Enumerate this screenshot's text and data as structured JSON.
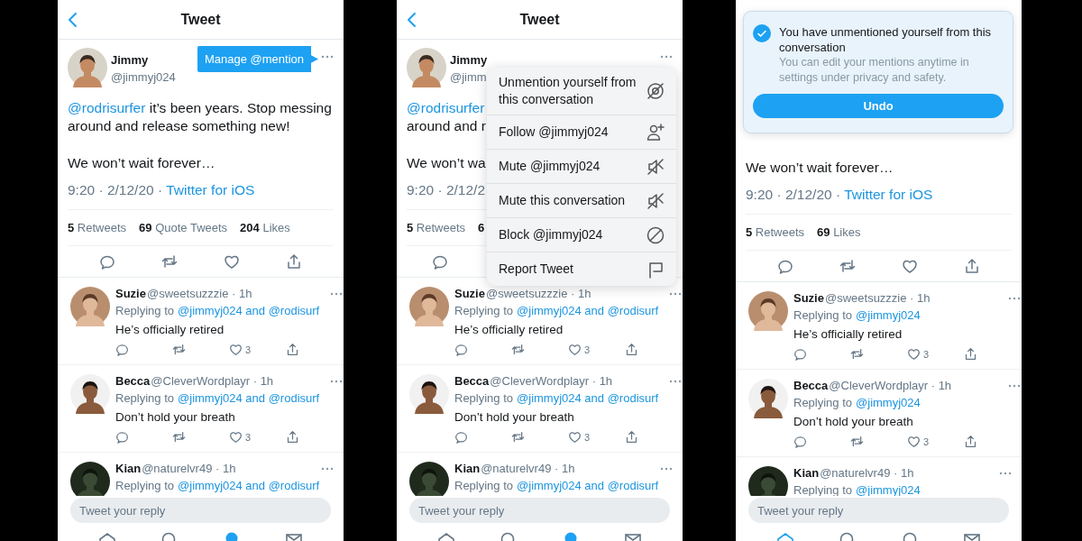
{
  "phones": [
    {
      "header": {
        "title": "Tweet"
      },
      "tweet": {
        "name": "Jimmy",
        "handle": "@jimmyj024",
        "body": [
          {
            "kind": "mention",
            "text": "@rodrisurfer"
          },
          {
            "kind": "text",
            "text": " it’s been years. Stop messing around and release something new!"
          }
        ],
        "body2": "We won’t wait forever…",
        "timestamp": "9:20 · 2/12/20 ·",
        "source": "Twitter for iOS",
        "stats": [
          {
            "count": "5",
            "label": "Retweets"
          },
          {
            "count": "69",
            "label": "Quote Tweets"
          },
          {
            "count": "204",
            "label": "Likes"
          }
        ],
        "actions": [
          {
            "kind": "reply"
          },
          {
            "kind": "retweet"
          },
          {
            "kind": "like"
          },
          {
            "kind": "share"
          }
        ]
      },
      "tooltip": {
        "label": "Manage @mention"
      },
      "replies": [
        {
          "name": "Suzie",
          "handle": "@sweetsuzzzie · 1h",
          "reply_to_label": "Replying to",
          "reply_to": "@jimmyj024 and @rodisurf",
          "text": "He’s officially retired",
          "likes": "3"
        },
        {
          "name": "Becca",
          "handle": "@CleverWordplayr · 1h",
          "reply_to_label": "Replying to",
          "reply_to": "@jimmyj024 and @rodisurf",
          "text": "Don’t hold your breath",
          "likes": "3"
        },
        {
          "name": "Kian",
          "handle": "@naturelvr49 · 1h",
          "reply_to_label": "Replying to",
          "reply_to": "@jimmyj024 and @rodisurf"
        }
      ],
      "compose": {
        "placeholder": "Tweet your reply"
      },
      "nav": [
        {
          "kind": "home",
          "selected": false
        },
        {
          "kind": "search",
          "selected": false
        },
        {
          "kind": "notifications",
          "selected": false,
          "badge": true
        },
        {
          "kind": "messages",
          "selected": false
        }
      ]
    },
    {
      "header": {
        "title": "Tweet"
      },
      "tweet": {
        "name": "Jimmy",
        "handle": "@jimm",
        "body": [
          {
            "kind": "mention",
            "text": "@rodrisurfer"
          },
          {
            "kind": "break"
          },
          {
            "kind": "text",
            "text": "around and r"
          }
        ],
        "body2": "We won’t wa",
        "timestamp": "9:20 · 2/12/2",
        "stats": [
          {
            "count": "5",
            "label": "Retweets"
          },
          {
            "count": "6"
          }
        ],
        "actions": [
          {
            "kind": "reply"
          }
        ]
      },
      "menu": {
        "items": [
          {
            "label": "Unmention yourself from this conversation",
            "kind": "unmention"
          },
          {
            "label": "Follow @jimmyj024",
            "kind": "follow"
          },
          {
            "label": "Mute @jimmyj024",
            "kind": "mute"
          },
          {
            "label": "Mute this conversation",
            "kind": "mute"
          },
          {
            "label": "Block @jimmyj024",
            "kind": "block"
          },
          {
            "label": "Report Tweet",
            "kind": "report"
          }
        ]
      },
      "replies": [
        {
          "name": "Suzie",
          "handle": "@sweetsuzzzie · 1h",
          "reply_to_label": "Replying to",
          "reply_to": "@jimmyj024 and @rodisurf",
          "text": "He’s officially retired",
          "likes": "3"
        },
        {
          "name": "Becca",
          "handle": "@CleverWordplayr · 1h",
          "reply_to_label": "Replying to",
          "reply_to": "@jimmyj024 and @rodisurf",
          "text": "Don’t hold your breath",
          "likes": "3"
        },
        {
          "name": "Kian",
          "handle": "@naturelvr49 · 1h",
          "reply_to_label": "Replying to",
          "reply_to": "@jimmyj024 and @rodisurf"
        }
      ],
      "compose": {
        "placeholder": "Tweet your reply"
      },
      "nav": [
        {
          "kind": "home",
          "selected": false
        },
        {
          "kind": "search",
          "selected": false
        },
        {
          "kind": "notifications",
          "selected": false,
          "badge": true
        },
        {
          "kind": "messages",
          "selected": false
        }
      ]
    },
    {
      "tweet": {
        "body2": "We won’t wait forever…",
        "timestamp": "9:20 · 2/12/20 ·",
        "source": "Twitter for iOS",
        "stats": [
          {
            "count": "5",
            "label": "Retweets"
          },
          {
            "count": "69",
            "label": "Likes"
          }
        ],
        "actions": [
          {
            "kind": "reply"
          },
          {
            "kind": "retweet"
          },
          {
            "kind": "like"
          },
          {
            "kind": "share"
          }
        ]
      },
      "toast": {
        "checked": true,
        "title": "You have unmentioned yourself from this conversation",
        "message": "You can edit your mentions anytime in settings under privacy and safety.",
        "button": "Undo"
      },
      "replies": [
        {
          "name": "Suzie",
          "handle": "@sweetsuzzzie · 1h",
          "reply_to_label": "Replying to",
          "reply_to": "@jimmyj024",
          "text": "He’s officially retired",
          "likes": "3"
        },
        {
          "name": "Becca",
          "handle": "@CleverWordplayr · 1h",
          "reply_to_label": "Replying to",
          "reply_to": "@jimmyj024",
          "text": "Don’t hold your breath",
          "likes": "3"
        },
        {
          "name": "Kian",
          "handle": "@naturelvr49 · 1h",
          "reply_to_label": "Replying to",
          "reply_to": "@jimmyj024"
        }
      ],
      "compose": {
        "placeholder": "Tweet your reply"
      },
      "nav": [
        {
          "kind": "home",
          "selected": true
        },
        {
          "kind": "search",
          "selected": false
        },
        {
          "kind": "notifications",
          "selected": false,
          "badge": false
        },
        {
          "kind": "messages",
          "selected": false
        }
      ]
    }
  ]
}
